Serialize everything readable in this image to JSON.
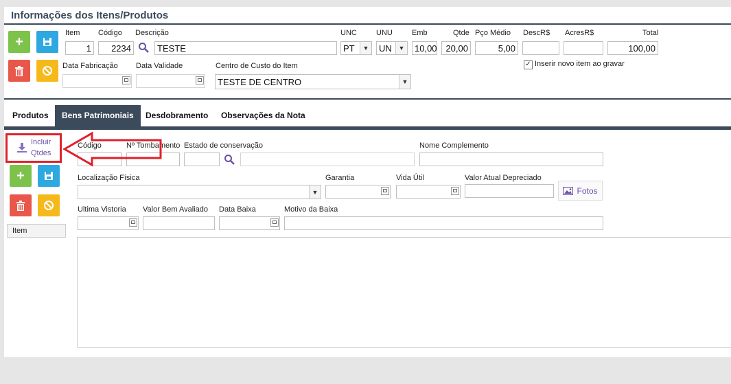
{
  "title": "Informações dos Itens/Produtos",
  "header": {
    "labels": {
      "item": "Item",
      "codigo": "Código",
      "descricao": "Descrição",
      "unc": "UNC",
      "unu": "UNU",
      "emb": "Emb",
      "qtde": "Qtde",
      "pco_medio": "Pço Médio",
      "desc": "DescR$",
      "acres": "AcresR$",
      "total": "Total",
      "data_fabricacao": "Data Fabricação",
      "data_validade": "Data Validade",
      "centro_custo": "Centro de Custo do Item"
    },
    "values": {
      "item": "1",
      "codigo": "2234",
      "descricao": "TESTE",
      "unc": "PT",
      "unu": "UN",
      "emb": "10,00",
      "qtde": "20,00",
      "pco_medio": "5,00",
      "desc": "",
      "acres": "",
      "total": "100,00",
      "data_fabricacao": "",
      "data_validade": "",
      "centro_custo": "TESTE DE CENTRO"
    },
    "checkbox_label": "Inserir novo item ao gravar",
    "checkbox_checked": true
  },
  "tabs": [
    "Produtos",
    "Bens Patrimoniais",
    "Desdobramento",
    "Observações da Nota"
  ],
  "active_tab": "Bens Patrimoniais",
  "side": {
    "incluir_label_1": "Incluir",
    "incluir_label_2": "Qtdes",
    "grid_header": "Item"
  },
  "bens": {
    "labels": {
      "codigo": "Código",
      "tombamento": "Nº Tombamento",
      "estado": "Estado de conservação",
      "nome_complemento": "Nome Complemento",
      "localizacao": "Localização Física",
      "garantia": "Garantia",
      "vida_util": "Vida Útil",
      "valor_atual": "Valor Atual Depreciado",
      "ultima_vistoria": "Ultima Vistoria",
      "valor_bem": "Valor Bem Avaliado",
      "data_baixa": "Data Baixa",
      "motivo_baixa": "Motivo da Baixa"
    },
    "fotos_label": "Fotos"
  },
  "colors": {
    "accent": "#3b4b5c",
    "green": "#7dc24b",
    "blue": "#2ea8e0",
    "red": "#e9574a",
    "yellow": "#f6b91c",
    "link": "#6a4ea8",
    "annotation": "#e0202a"
  }
}
